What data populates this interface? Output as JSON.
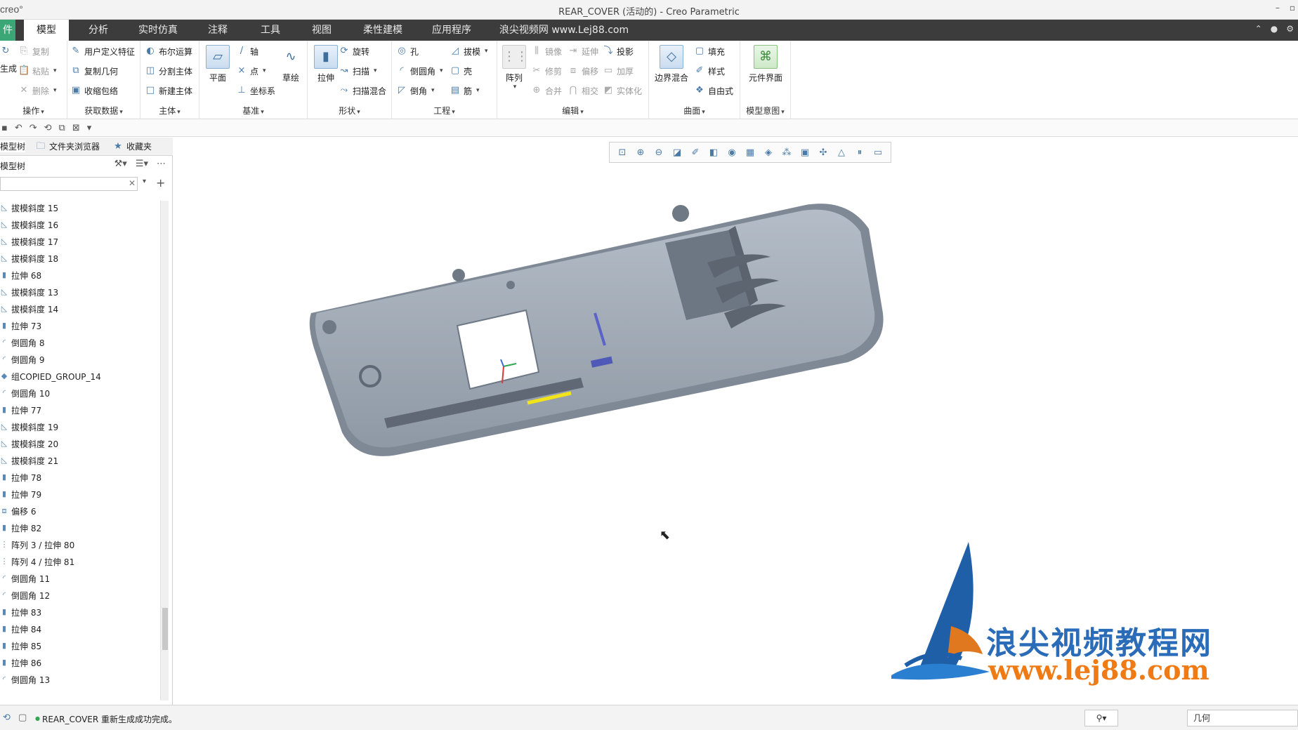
{
  "titlebar": {
    "logo": "creo°",
    "title": "REAR_COVER (活动的) - Creo Parametric",
    "min": "–",
    "max": "▫"
  },
  "tabs": {
    "file": "件",
    "items": [
      "模型",
      "分析",
      "实时仿真",
      "注释",
      "工具",
      "视图",
      "柔性建模",
      "应用程序",
      "浪尖视频网 www.Lej88.com"
    ]
  },
  "ribbon": {
    "operations": {
      "label": "操作",
      "regen": "生成",
      "copy": "复制",
      "paste": "粘贴",
      "delete": "删除"
    },
    "getdata": {
      "label": "获取数据",
      "udf": "用户定义特征",
      "copygeom": "复制几何",
      "shrinkwrap": "收缩包络"
    },
    "body": {
      "label": "主体",
      "boolean": "布尔运算",
      "split": "分割主体",
      "newbody": "新建主体"
    },
    "datum": {
      "label": "基准",
      "plane": "平面",
      "axis": "轴",
      "point": "点",
      "csys": "坐标系",
      "sketch": "草绘"
    },
    "shapes": {
      "label": "形状",
      "extrude": "拉伸",
      "revolve": "旋转",
      "sweep": "扫描",
      "sweptblend": "扫描混合"
    },
    "engineering": {
      "label": "工程",
      "hole": "孔",
      "round": "倒圆角",
      "chamfer": "倒角",
      "draft": "拔模",
      "shell": "壳",
      "rib": "筋"
    },
    "editing": {
      "label": "编辑",
      "pattern": "阵列",
      "mirror": "镜像",
      "trim": "修剪",
      "merge": "合并",
      "extend": "延伸",
      "offset": "偏移",
      "intersect": "相交",
      "project": "投影",
      "thicken": "加厚",
      "solidify": "实体化"
    },
    "surfaces": {
      "label": "曲面",
      "boundary": "边界混合",
      "fill": "填充",
      "style": "样式",
      "freestyle": "自由式"
    },
    "intent": {
      "label": "模型意图",
      "component": "元件界面"
    }
  },
  "leftpanel": {
    "tabs": [
      "模型树",
      "文件夹浏览器",
      "收藏夹"
    ],
    "header": "模型树",
    "search": {
      "value": "",
      "placeholder": ""
    },
    "items": [
      "拔模斜度 15",
      "拔模斜度 16",
      "拔模斜度 17",
      "拔模斜度 18",
      "拉伸 68",
      "拔模斜度 13",
      "拔模斜度 14",
      "拉伸 73",
      "倒圆角 8",
      "倒圆角 9",
      "组COPIED_GROUP_14",
      "倒圆角 10",
      "拉伸 77",
      "拔模斜度 19",
      "拔模斜度 20",
      "拔模斜度 21",
      "拉伸 78",
      "拉伸 79",
      "偏移 6",
      "拉伸 82",
      "阵列 3 / 拉伸 80",
      "阵列 4 / 拉伸 81",
      "倒圆角 11",
      "倒圆角 12",
      "拉伸 83",
      "拉伸 84",
      "拉伸 85",
      "拉伸 86",
      "倒圆角 13"
    ]
  },
  "watermark": {
    "cn": "浪尖视频教程网",
    "url": "www.lej88.com"
  },
  "statusbar": {
    "message": "REAR_COVER 重新生成成功完成。",
    "filter_placeholder": "几何"
  },
  "colors": {
    "tabbar": "#3c3c3c",
    "file_tab": "#3ba776",
    "model_body": "#9aa5b1",
    "highlight_edge": "#f2e41a"
  }
}
